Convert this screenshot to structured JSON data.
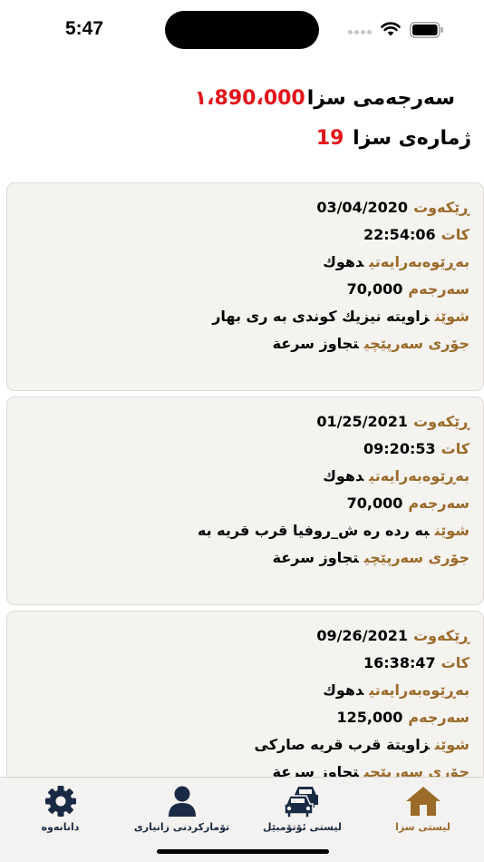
{
  "status_bar": {
    "time": "5:47"
  },
  "summary": {
    "total_fines_label": "سەرجەمی سزا",
    "total_fines_value": "١،890،000",
    "fines_count_label": "ژمارەی سزا",
    "fines_count_value": "19",
    "value_color": "#e3141b"
  },
  "fines": [
    {
      "date_label": "ڕێکەوت",
      "date": "03/04/2020",
      "time_label": "کات",
      "time": "22:54:06",
      "directorate_label": "بەڕێوەبەرایەتی",
      "directorate": "دهوك",
      "amount_label": "سەرجەم",
      "amount": "70,000",
      "location_label": "شوێن",
      "location": "زاويته نيزيك كوندى به رى بهار",
      "violation_label": "جۆری سەرپێچی",
      "violation": "تجاوز سرعة"
    },
    {
      "date_label": "ڕێکەوت",
      "date": "01/25/2021",
      "time_label": "کات",
      "time": "09:20:53",
      "directorate_label": "بەڕێوەبەرایەتی",
      "directorate": "دهوك",
      "amount_label": "سەرجەم",
      "amount": "70,000",
      "location_label": "شوێن",
      "location": "به رده ره ش_روفيا قرب قريه به",
      "violation_label": "جۆری سەرپێچی",
      "violation": "تجاوز سرعة"
    },
    {
      "date_label": "ڕێکەوت",
      "date": "09/26/2021",
      "time_label": "کات",
      "time": "16:38:47",
      "directorate_label": "بەڕێوەبەرایەتی",
      "directorate": "دهوك",
      "amount_label": "سەرجەم",
      "amount": "125,000",
      "location_label": "شوێن",
      "location": "زاويتة قرب قريه صاركى",
      "violation_label": "جۆری سەرپێچی",
      "violation": "تجاوز سرعة"
    }
  ],
  "tabbar": {
    "items": [
      {
        "label": "لیستی سزا",
        "icon": "home-icon",
        "active": true
      },
      {
        "label": "لیستی ئۆتۆمبێل",
        "icon": "cars-icon",
        "active": false
      },
      {
        "label": "تۆمارکردنی زانیاری",
        "icon": "user-icon",
        "active": false
      },
      {
        "label": "دانانەوە",
        "icon": "gear-icon",
        "active": false
      }
    ],
    "active_color": "#9b6b2a",
    "icon_color": "#1a2a44"
  }
}
